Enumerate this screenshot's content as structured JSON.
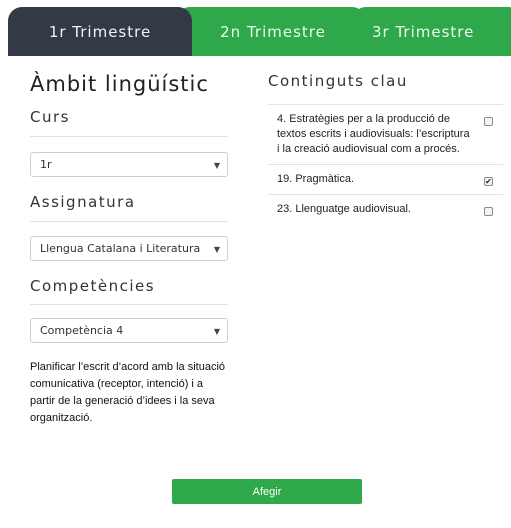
{
  "tabs": [
    {
      "label": "1r Trimestre"
    },
    {
      "label": "2n Trimestre"
    },
    {
      "label": "3r Trimestre"
    }
  ],
  "colors": {
    "dark_tab": "#343a45",
    "accent": "#2ea84a"
  },
  "left": {
    "title": "Àmbit lingüístic",
    "course": {
      "label": "Curs",
      "selected": "1r"
    },
    "subject": {
      "label": "Assignatura",
      "selected": "Llengua Catalana i Literatura"
    },
    "competences": {
      "label": "Competències",
      "selected": "Competència 4"
    },
    "description": "Planificar l’escrit d’acord amb la situació comunicativa (receptor, intenció) i a partir de la generació d’idees i la seva organització."
  },
  "right": {
    "title": "Continguts clau",
    "items": [
      {
        "text": "4. Estratègies per a la producció de textos escrits i audiovisuals: l’escriptura i la creació audiovisual com a procés.",
        "checked": false
      },
      {
        "text": "19. Pragmàtica.",
        "checked": true
      },
      {
        "text": "23. Llenguatge audiovisual.",
        "checked": false
      }
    ]
  },
  "button": {
    "label": "Afegir"
  }
}
